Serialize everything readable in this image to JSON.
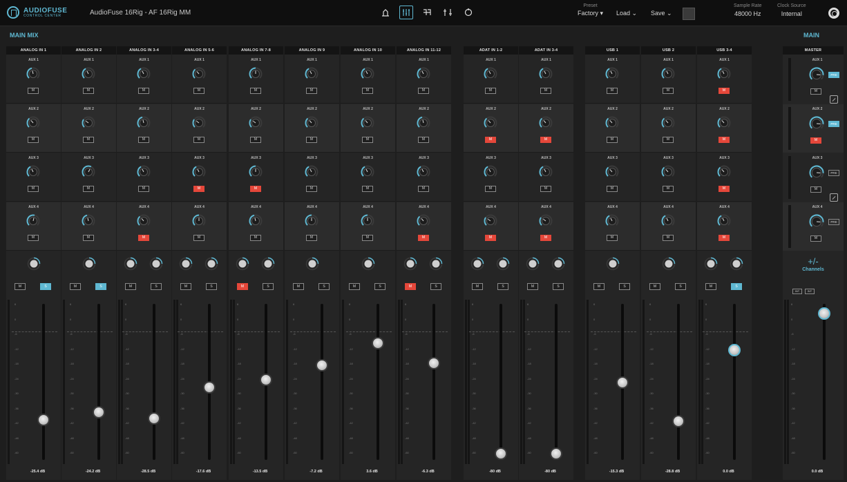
{
  "header": {
    "logo_line1": "AUDIOFUSE",
    "logo_line2": "CONTROL CENTER",
    "device": "AudioFuse 16Rig - AF 16Rig MM",
    "toolbar_icons": [
      "presets-icon",
      "mixer-icon",
      "routing-icon",
      "settings-sliders-icon",
      "refresh-icon"
    ],
    "active_icon": 1,
    "preset_label": "Preset",
    "preset_value": "Factory",
    "load_label": "Load",
    "save_label": "Save",
    "sample_rate_label": "Sample Rate",
    "sample_rate_value": "48000 Hz",
    "clock_source_label": "Clock Source",
    "clock_source_value": "Internal"
  },
  "main_mix_title": "MAIN MIX",
  "main_title": "MAIN",
  "colors": {
    "accent": "#5fb8d2",
    "mute": "#e5473a",
    "background": "#1e1e1e"
  },
  "aux_labels": [
    "AUX 1",
    "AUX 2",
    "AUX 3",
    "AUX 4"
  ],
  "channels": [
    {
      "name": "ANALOG IN 1",
      "aux_mute": [
        false,
        false,
        false,
        false
      ],
      "aux_level": [
        0.45,
        0.35,
        0.4,
        0.55
      ],
      "stereo": false,
      "mute": false,
      "solo": true,
      "fader": 0.23,
      "db": "-25.4 dB"
    },
    {
      "name": "ANALOG IN 2",
      "aux_mute": [
        false,
        false,
        false,
        false
      ],
      "aux_level": [
        0.4,
        0.3,
        0.6,
        0.45
      ],
      "stereo": false,
      "mute": false,
      "solo": true,
      "fader": 0.28,
      "db": "-24.2 dB"
    },
    {
      "name": "ANALOG IN 3-4",
      "aux_mute": [
        false,
        false,
        false,
        true
      ],
      "aux_level": [
        0.4,
        0.45,
        0.4,
        0.35
      ],
      "stereo": true,
      "mute": false,
      "solo": false,
      "fader": 0.24,
      "db": "-28.5 dB"
    },
    {
      "name": "ANALOG IN 5-6",
      "aux_mute": [
        false,
        false,
        true,
        false
      ],
      "aux_level": [
        0.35,
        0.3,
        0.4,
        0.5
      ],
      "stereo": true,
      "mute": false,
      "solo": false,
      "fader": 0.45,
      "db": "-17.6 dB"
    },
    {
      "name": "ANALOG IN 7-8",
      "aux_mute": [
        false,
        false,
        true,
        false
      ],
      "aux_level": [
        0.5,
        0.3,
        0.5,
        0.45
      ],
      "stereo": true,
      "mute": true,
      "solo": false,
      "fader": 0.5,
      "db": "-13.5 dB"
    },
    {
      "name": "ANALOG IN 9",
      "aux_mute": [
        false,
        false,
        false,
        false
      ],
      "aux_level": [
        0.4,
        0.35,
        0.4,
        0.5
      ],
      "stereo": false,
      "mute": false,
      "solo": false,
      "fader": 0.6,
      "db": "-7.2 dB"
    },
    {
      "name": "ANALOG IN 10",
      "aux_mute": [
        false,
        false,
        false,
        false
      ],
      "aux_level": [
        0.4,
        0.35,
        0.4,
        0.5
      ],
      "stereo": false,
      "mute": false,
      "solo": false,
      "fader": 0.75,
      "db": "3.6 dB"
    },
    {
      "name": "ANALOG IN 11-12",
      "aux_mute": [
        false,
        false,
        false,
        true
      ],
      "aux_level": [
        0.4,
        0.45,
        0.4,
        0.35
      ],
      "stereo": true,
      "mute": true,
      "solo": false,
      "fader": 0.61,
      "db": "-6.3 dB"
    },
    {
      "name": "ADAT IN 1-2",
      "aux_mute": [
        false,
        true,
        false,
        true
      ],
      "aux_level": [
        0.4,
        0.35,
        0.4,
        0.3
      ],
      "stereo": true,
      "mute": false,
      "solo": false,
      "fader": 0.0,
      "db": "-80 dB"
    },
    {
      "name": "ADAT IN 3-4",
      "aux_mute": [
        false,
        true,
        false,
        true
      ],
      "aux_level": [
        0.4,
        0.35,
        0.4,
        0.3
      ],
      "stereo": true,
      "mute": false,
      "solo": false,
      "fader": 0.0,
      "db": "-80 dB"
    },
    {
      "name": "USB 1",
      "aux_mute": [
        false,
        false,
        false,
        false
      ],
      "aux_level": [
        0.4,
        0.35,
        0.35,
        0.4
      ],
      "stereo": false,
      "mute": false,
      "solo": false,
      "fader": 0.48,
      "db": "-15.3 dB"
    },
    {
      "name": "USB 2",
      "aux_mute": [
        false,
        false,
        false,
        false
      ],
      "aux_level": [
        0.4,
        0.35,
        0.35,
        0.4
      ],
      "stereo": false,
      "mute": false,
      "solo": false,
      "fader": 0.22,
      "db": "-28.8 dB"
    },
    {
      "name": "USB 3-4",
      "aux_mute": [
        true,
        true,
        true,
        true
      ],
      "aux_level": [
        0.4,
        0.35,
        0.35,
        0.4
      ],
      "stereo": true,
      "mute": false,
      "solo": true,
      "fader": 0.7,
      "db": "0.0 dB"
    }
  ],
  "master": {
    "name": "MASTER",
    "aux_mute": [
      false,
      true,
      false,
      false
    ],
    "pre_on": [
      true,
      true,
      false,
      false
    ],
    "pre_label": "PRE",
    "plus_minus": "+/-",
    "channels_label": "Channels",
    "mini_labels": [
      "INT",
      "INT"
    ],
    "fader": 0.95,
    "db": "0.0 dB"
  },
  "labels": {
    "mute": "M",
    "solo": "S"
  },
  "scale_ticks": [
    "6",
    "0",
    "-6",
    "-12",
    "-18",
    "-24",
    "-30",
    "-36",
    "-42",
    "-48",
    "-60"
  ]
}
